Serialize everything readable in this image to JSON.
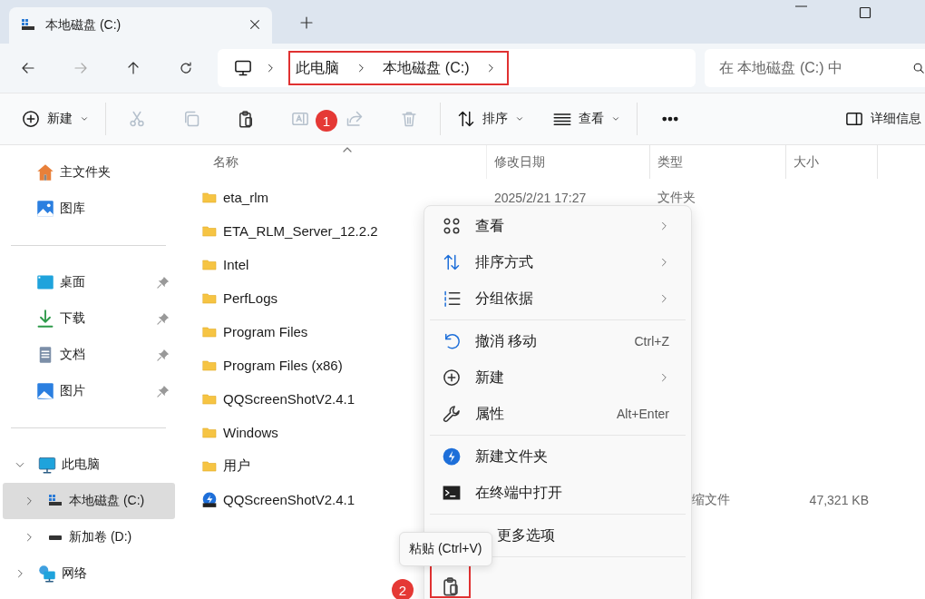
{
  "window": {
    "tab_title": "本地磁盘 (C:)"
  },
  "navigation": {
    "buttons": [
      {
        "disabled": false
      },
      {
        "disabled": true
      },
      {
        "disabled": false
      },
      {
        "disabled": false
      }
    ]
  },
  "address_bar": {
    "crumbs": [
      "此电脑",
      "本地磁盘 (C:)"
    ]
  },
  "search": {
    "placeholder": "在 本地磁盘 (C:) 中"
  },
  "toolbar": {
    "new": "新建",
    "actions": [
      {
        "disabled": true
      },
      {
        "disabled": true
      },
      {
        "disabled": false
      },
      {
        "disabled": true
      },
      {
        "disabled": true
      },
      {
        "disabled": true
      }
    ],
    "sort": "排序",
    "view": "查看",
    "details": "详细信息"
  },
  "sidebar": {
    "sections": [
      {
        "items": [
          {
            "label": "主文件夹"
          },
          {
            "label": "图库"
          }
        ]
      },
      {
        "items": [
          {
            "label": "桌面",
            "pinned": true
          },
          {
            "label": "下载",
            "pinned": true
          },
          {
            "label": "文档",
            "pinned": true
          },
          {
            "label": "图片",
            "pinned": true
          }
        ]
      },
      {
        "items": [
          {
            "label": "此电脑",
            "expanded": true,
            "selected": false,
            "children": [
              {
                "label": "本地磁盘 (C:)",
                "expanded": false,
                "selected": true
              },
              {
                "label": "新加卷 (D:)",
                "expanded": false,
                "selected": false
              }
            ]
          },
          {
            "label": "网络",
            "expanded": false,
            "selected": false
          }
        ]
      }
    ]
  },
  "table": {
    "columns": [
      "名称",
      "修改日期",
      "类型",
      "大小"
    ],
    "rows": [
      {
        "kind": "folder",
        "name": "eta_rlm",
        "date": "2025/2/21 17:27",
        "type": "文件夹"
      },
      {
        "kind": "folder",
        "name": "ETA_RLM_Server_12.2.2"
      },
      {
        "kind": "folder",
        "name": "Intel"
      },
      {
        "kind": "folder",
        "name": "PerfLogs"
      },
      {
        "kind": "folder",
        "name": "Program Files"
      },
      {
        "kind": "folder",
        "name": "Program Files (x86)"
      },
      {
        "kind": "folder",
        "name": "QQScreenShotV2.4.1"
      },
      {
        "kind": "folder",
        "name": "Windows"
      },
      {
        "kind": "folder",
        "name": "用户"
      },
      {
        "kind": "zip",
        "name": "QQScreenShotV2.4.1",
        "type": "缩文件",
        "size": "47,321 KB"
      }
    ]
  },
  "context_menu": {
    "items": [
      {
        "kind": "item",
        "label": "查看",
        "submenu": true
      },
      {
        "kind": "item",
        "label": "排序方式",
        "submenu": true
      },
      {
        "kind": "item",
        "label": "分组依据",
        "submenu": true
      },
      {
        "kind": "separator"
      },
      {
        "kind": "item",
        "label": "撤消 移动",
        "shortcut": "Ctrl+Z",
        "submenu": false
      },
      {
        "kind": "item",
        "label": "新建",
        "submenu": true
      },
      {
        "kind": "item",
        "label": "属性",
        "shortcut": "Alt+Enter",
        "submenu": false
      },
      {
        "kind": "separator"
      },
      {
        "kind": "item",
        "label": "新建文件夹",
        "submenu": false
      },
      {
        "kind": "item",
        "label": "在终端中打开",
        "submenu": false
      },
      {
        "kind": "separator"
      },
      {
        "kind": "more",
        "label": "更多选项"
      },
      {
        "kind": "separator"
      },
      {
        "kind": "actions"
      }
    ]
  },
  "tooltip": {
    "text": "粘贴 (Ctrl+V)"
  },
  "annotations": {
    "badges": [
      "1",
      "2"
    ]
  }
}
